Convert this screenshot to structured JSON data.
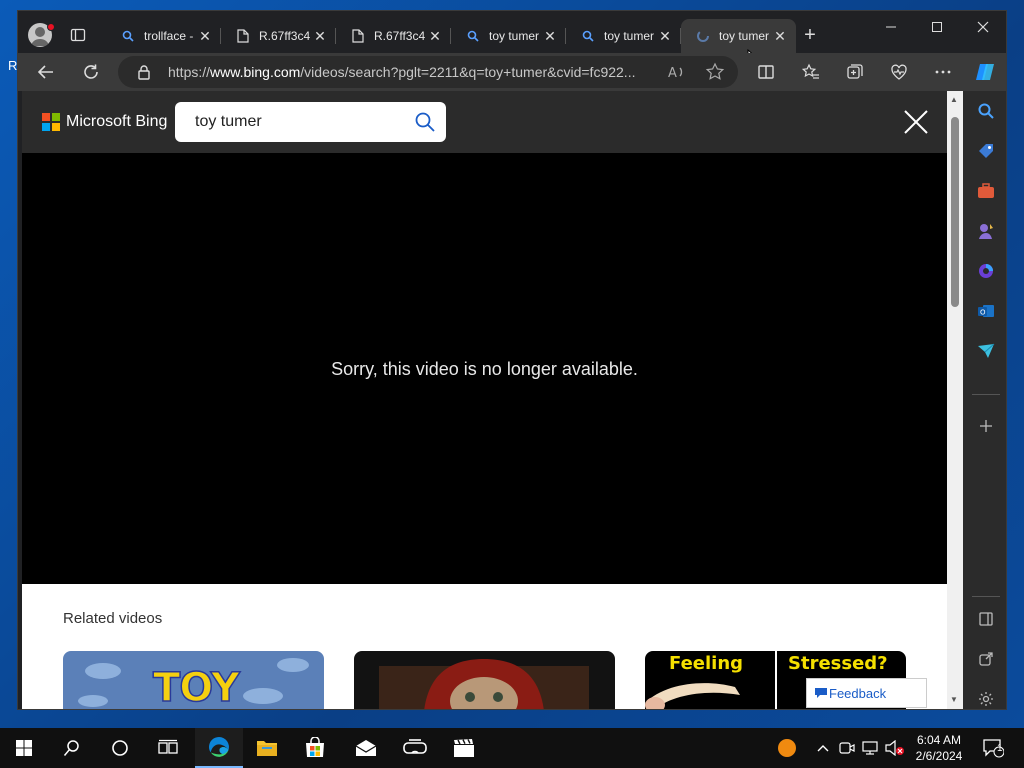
{
  "desktop": {
    "edge_letter": "R"
  },
  "browser": {
    "tabs": [
      {
        "title": "trollface -",
        "icon": "bing-search-icon",
        "active": false
      },
      {
        "title": "R.67ff3c4",
        "icon": "file-icon",
        "active": false
      },
      {
        "title": "R.67ff3c4",
        "icon": "file-icon",
        "active": false
      },
      {
        "title": "toy tumer",
        "icon": "bing-search-icon",
        "active": false
      },
      {
        "title": "toy tumer",
        "icon": "bing-search-icon",
        "active": false
      },
      {
        "title": "toy tumer",
        "icon": "bing-search-icon",
        "active": true
      }
    ],
    "address": {
      "prefix": "https://",
      "domain": "www.bing.com",
      "path": "/videos/search?pglt=2211&q=toy+tumer&cvid=fc922..."
    }
  },
  "bing": {
    "brand": "Microsoft Bing",
    "search_value": "toy tumer",
    "video_message": "Sorry, this video is no longer available.",
    "related_title": "Related videos",
    "thumb1_text": "TOY",
    "thumb3_left": "Feeling",
    "thumb3_right": "Stressed?",
    "feedback": "Feedback"
  },
  "taskbar": {
    "time": "6:04 AM",
    "date": "2/6/2024",
    "notification_count": "1"
  },
  "colors": {
    "accent": "#0078d4",
    "bing_dark": "#2b2b2b",
    "video_bg": "#000000"
  }
}
